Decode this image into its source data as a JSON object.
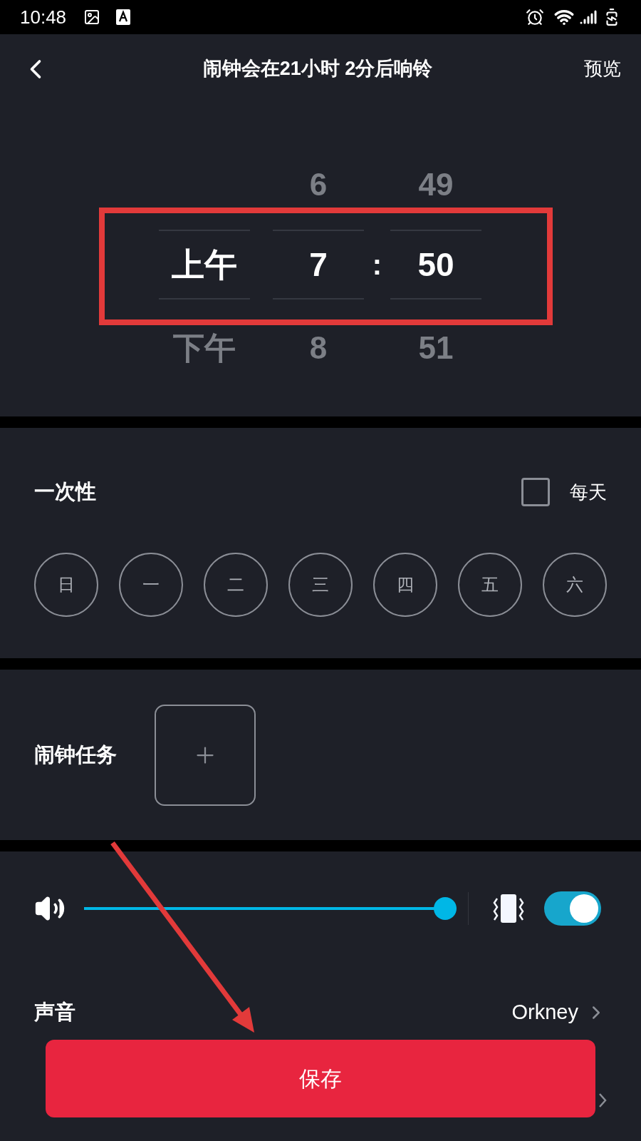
{
  "status_bar": {
    "time": "10:48"
  },
  "header": {
    "title": "闹钟会在21小时 2分后响铃",
    "action": "预览"
  },
  "picker": {
    "separator": ":",
    "columns": [
      {
        "selected": "上午",
        "below": "下午"
      },
      {
        "above": "6",
        "selected": "7",
        "below": "8"
      },
      {
        "above": "49",
        "selected": "50",
        "below": "51"
      }
    ]
  },
  "repeat": {
    "label": "一次性",
    "daily": {
      "label": "每天",
      "checked": false
    },
    "days": [
      {
        "label": "日",
        "selected": false
      },
      {
        "label": "一",
        "selected": false
      },
      {
        "label": "二",
        "selected": false
      },
      {
        "label": "三",
        "selected": false
      },
      {
        "label": "四",
        "selected": false
      },
      {
        "label": "五",
        "selected": false
      },
      {
        "label": "六",
        "selected": false
      }
    ]
  },
  "task": {
    "label": "闹钟任务"
  },
  "volume": {
    "level": 1,
    "vibrate": {
      "on": true
    }
  },
  "sound": {
    "label": "声音",
    "value": "Orkney"
  },
  "save_button": "保存"
}
